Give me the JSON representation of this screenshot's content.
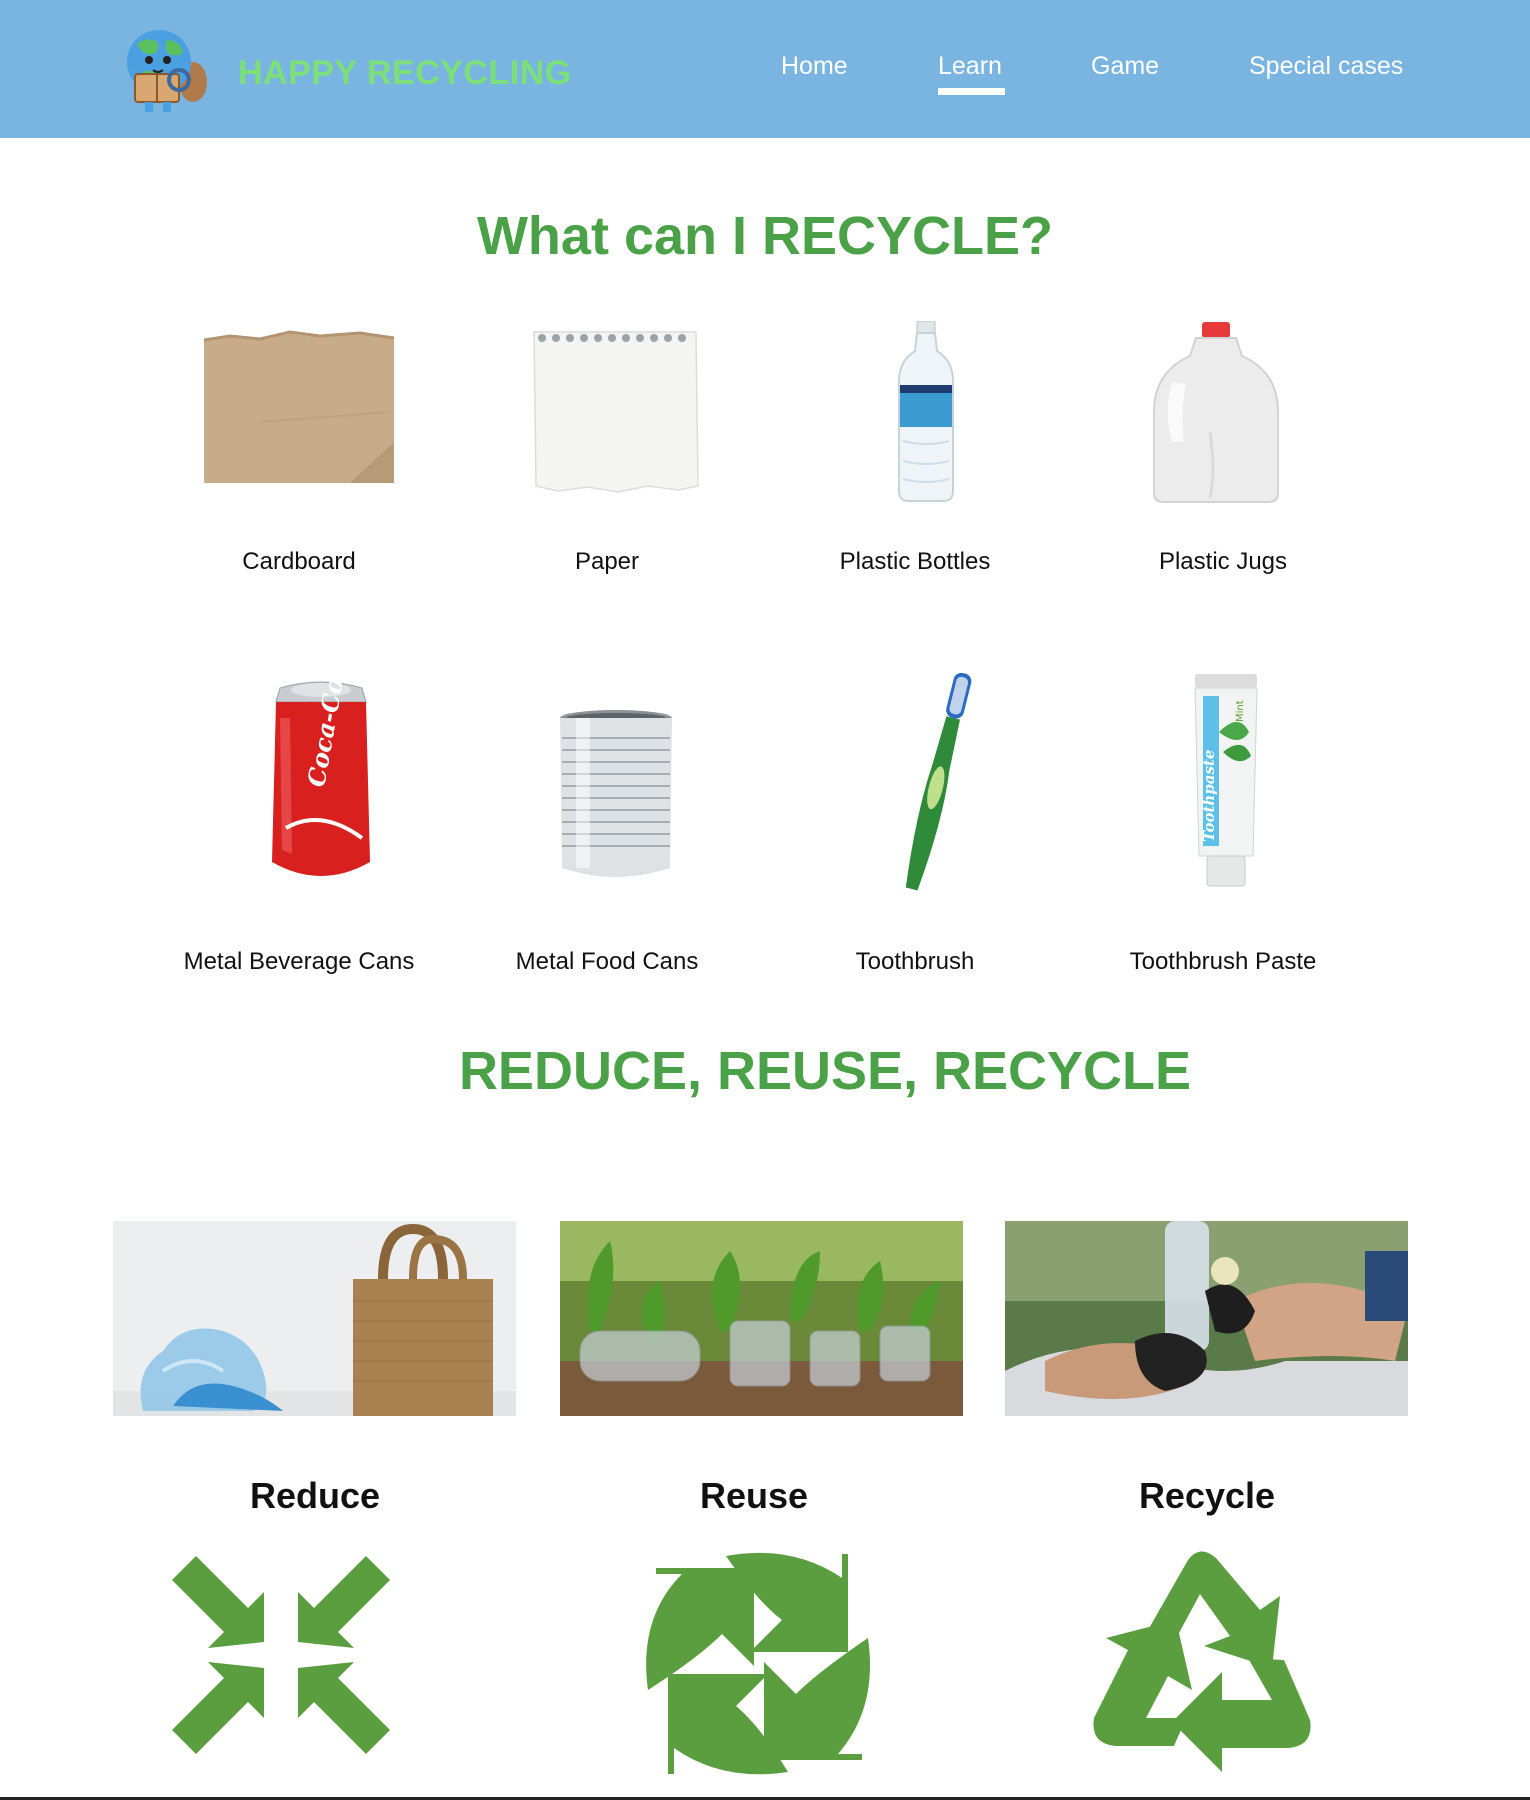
{
  "header": {
    "brand": "HAPPY RECYCLING",
    "logo_icon": "earth-mascot-icon",
    "nav": [
      {
        "label": "Home",
        "active": false
      },
      {
        "label": "Learn",
        "active": true
      },
      {
        "label": "Game",
        "active": false
      },
      {
        "label": "Special cases",
        "active": false
      }
    ]
  },
  "section1": {
    "title": "What can I RECYCLE?",
    "items": [
      {
        "label": "Cardboard",
        "icon": "cardboard-icon"
      },
      {
        "label": "Paper",
        "icon": "paper-icon"
      },
      {
        "label": "Plastic Bottles",
        "icon": "plastic-bottle-icon"
      },
      {
        "label": "Plastic Jugs",
        "icon": "plastic-jug-icon"
      },
      {
        "label": "Metal Beverage Cans",
        "icon": "beverage-can-icon"
      },
      {
        "label": "Metal Food Cans",
        "icon": "food-can-icon"
      },
      {
        "label": "Toothbrush",
        "icon": "toothbrush-icon"
      },
      {
        "label": "Toothbrush Paste",
        "icon": "toothpaste-icon"
      }
    ]
  },
  "section2": {
    "title": "REDUCE, REUSE, RECYCLE",
    "cards": [
      {
        "label": "Reduce",
        "photo": "plastic-bag-vs-tote-photo",
        "icon": "reduce-arrows-icon"
      },
      {
        "label": "Reuse",
        "photo": "bottle-planters-photo",
        "icon": "reuse-arrows-icon"
      },
      {
        "label": "Recycle",
        "photo": "hands-bottle-photo",
        "icon": "recycle-symbol-icon"
      }
    ]
  },
  "colors": {
    "header_bg": "#7ab4e0",
    "brand": "#7be07a",
    "title_green": "#4aa148",
    "icon_green": "#5a9e3f"
  },
  "can_text": "Coca-Cola",
  "paste_text": "Toothpaste",
  "paste_flavor": "Mint"
}
